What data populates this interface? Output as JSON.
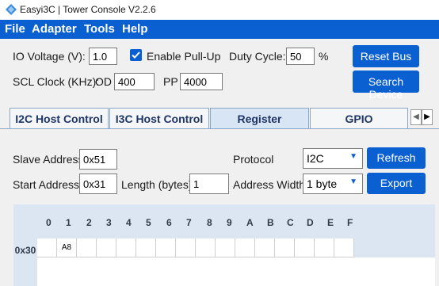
{
  "window": {
    "title": "Easyi3C | Tower Console V2.2.6"
  },
  "menu": {
    "items": [
      "File",
      "Adapter",
      "Tools",
      "Help"
    ]
  },
  "controls": {
    "io_voltage_label": "IO Voltage (V):",
    "io_voltage_value": "1.0",
    "pullup_label": "Enable Pull-Up",
    "pullup_checked": true,
    "duty_cycle_label": "Duty Cycle:",
    "duty_cycle_value": "50",
    "duty_cycle_unit": "%",
    "reset_bus_label": "Reset Bus",
    "scl_clock_label": "SCL Clock (KHz):",
    "od_label": "OD",
    "od_value": "400",
    "pp_label": "PP",
    "pp_value": "4000",
    "search_device_label": "Search Device"
  },
  "tabs": [
    {
      "label": "I2C Host Control",
      "active": false
    },
    {
      "label": "I3C Host Control",
      "active": false
    },
    {
      "label": "Register",
      "active": true
    },
    {
      "label": "GPIO",
      "active": false
    }
  ],
  "register": {
    "slave_address_label": "Slave Address",
    "slave_address_value": "0x51",
    "protocol_label": "Protocol",
    "protocol_value": "I2C",
    "refresh_label": "Refresh",
    "start_address_label": "Start Address",
    "start_address_value": "0x31",
    "length_label": "Length (bytes)",
    "length_value": "1",
    "address_width_label": "Address Width",
    "address_width_value": "1 byte",
    "export_label": "Export"
  },
  "grid": {
    "columns": [
      "0",
      "1",
      "2",
      "3",
      "4",
      "5",
      "6",
      "7",
      "8",
      "9",
      "A",
      "B",
      "C",
      "D",
      "E",
      "F"
    ],
    "rows": [
      {
        "label": "0x30",
        "cells": [
          "",
          "A8",
          "",
          "",
          "",
          "",
          "",
          "",
          "",
          "",
          "",
          "",
          "",
          "",
          "",
          ""
        ]
      }
    ]
  },
  "colors": {
    "accent": "#0a5fd1",
    "grid_header": "#dce6f2"
  }
}
